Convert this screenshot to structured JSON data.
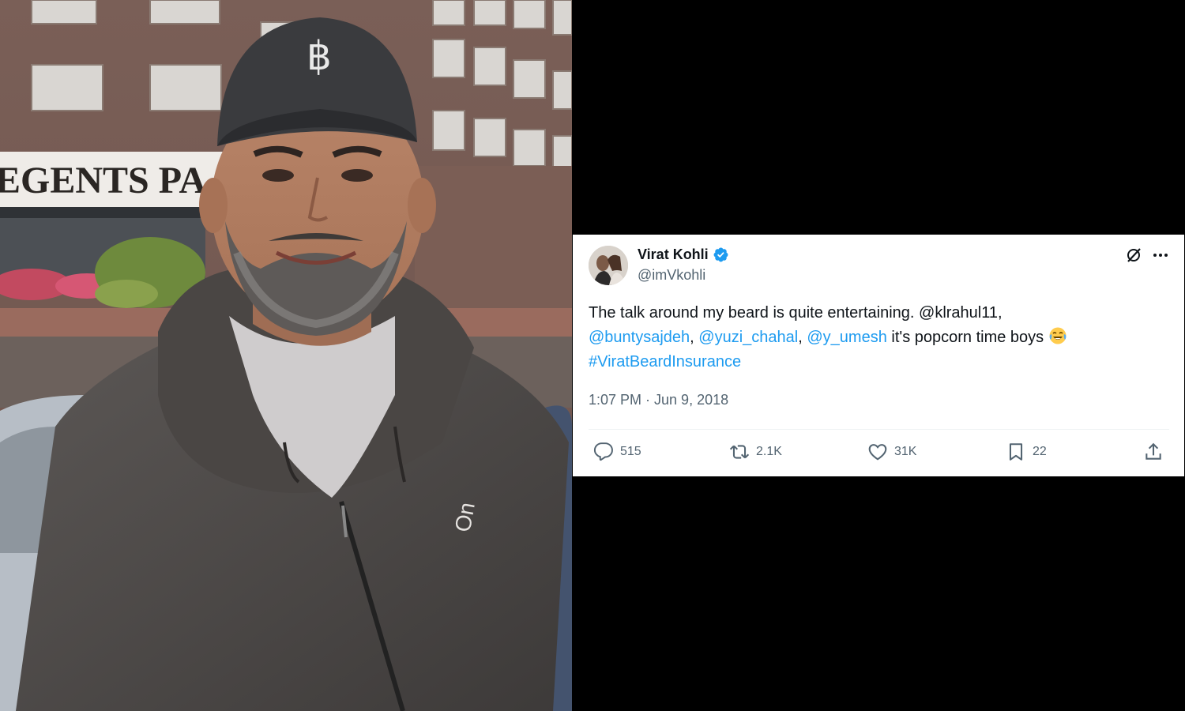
{
  "photo": {
    "sign_text": "EGENTS PA",
    "cap_logo": "฿"
  },
  "tweet": {
    "author_name": "Virat Kohli",
    "author_handle": "@imVkohli",
    "verified": true,
    "text_parts": {
      "p1": "The talk around my beard is quite entertaining. @klrahul11,",
      "m1": "@buntysajdeh",
      "s1": ", ",
      "m2": "@yuzi_chahal",
      "s2": ", ",
      "m3": "@y_umesh",
      "p2": " it's popcorn time boys ",
      "hashtag": "#ViratBeardInsurance"
    },
    "emoji": "face-with-tears-of-joy",
    "timestamp": "1:07 PM · Jun 9, 2018",
    "stats": {
      "replies": "515",
      "retweets": "2.1K",
      "likes": "31K",
      "bookmarks": "22"
    },
    "icons": [
      "grok-icon",
      "more-icon",
      "reply-icon",
      "retweet-icon",
      "like-icon",
      "bookmark-icon",
      "share-icon"
    ]
  },
  "colors": {
    "link": "#1d9bf0",
    "verified": "#1d9bf0",
    "text": "#0f1419",
    "secondary": "#536471"
  }
}
